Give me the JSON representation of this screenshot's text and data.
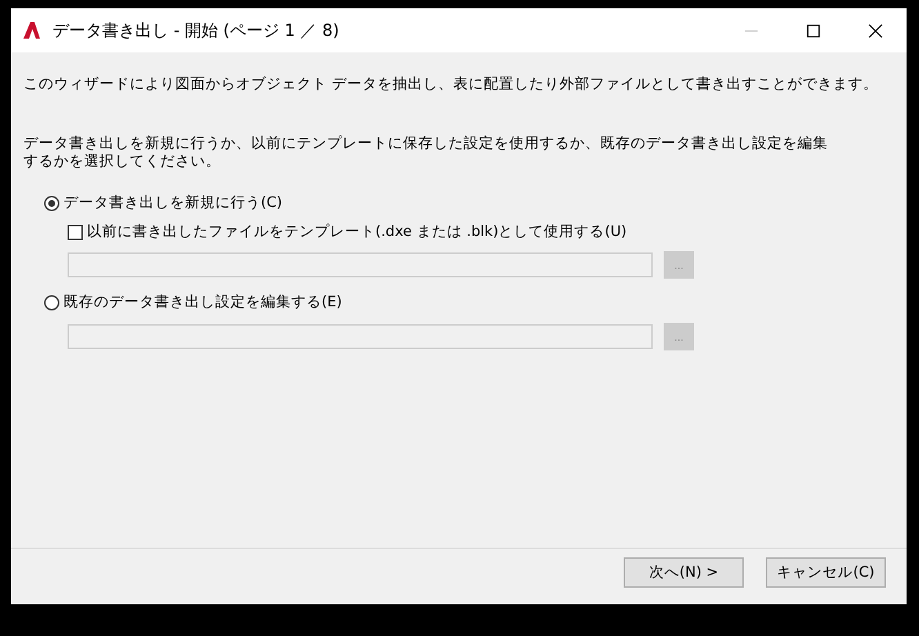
{
  "window": {
    "title": "データ書き出し - 開始 (ページ 1 ／ 8)"
  },
  "intro": "このウィザードにより図面からオブジェクト データを抽出し、表に配置したり外部ファイルとして書き出すことができます。",
  "question": "データ書き出しを新規に行うか、以前にテンプレートに保存した設定を使用するか、既存のデータ書き出し設定を編集するかを選択してください。",
  "options": [
    {
      "label": "データ書き出しを新規に行う(C)",
      "selected": true,
      "template": {
        "label": "以前に書き出したファイルをテンプレート(.dxe または .blk)として使用する(U)",
        "checked": false
      },
      "browse": "...",
      "disabled": true
    },
    {
      "label": "既存のデータ書き出し設定を編集する(E)",
      "selected": false,
      "browse": "...",
      "disabled": true
    }
  ],
  "buttons": [
    {
      "label": "次へ(N) >"
    },
    {
      "label": "キャンセル(C)"
    }
  ]
}
